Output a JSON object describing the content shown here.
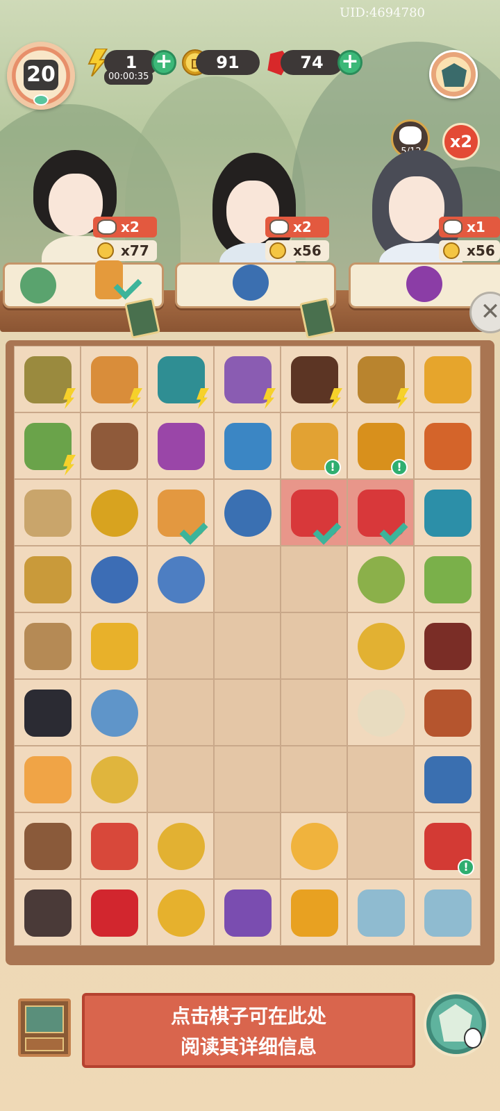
{
  "uid": "UID:4694780",
  "player": {
    "level": "20"
  },
  "resources": {
    "energy": "1",
    "energy_timer": "00:00:35",
    "coins": "91",
    "rubies": "74"
  },
  "cat_collection": {
    "count": "5/12",
    "multiplier": "x2"
  },
  "customers": [
    {
      "reward_cats": "x2",
      "reward_coins": "x77"
    },
    {
      "reward_cats": "x2",
      "reward_coins": "x56"
    },
    {
      "reward_cats": "x1",
      "reward_coins": "x56"
    }
  ],
  "info_panel": {
    "line1": "点击棋子可在此处",
    "line2": "阅读其详细信息"
  },
  "colors": {
    "accent_red": "#e3593f",
    "accent_green": "#3cb878",
    "board_wood": "#a97552",
    "cell": "#f1d9bd"
  },
  "board": [
    [
      "basket-of-thread",
      "fruit-crate",
      "teapot-set",
      "thread-spool",
      "treasure-chest",
      "tool-crate",
      "hen-nest"
    ],
    [
      "vegetable-basket",
      "bird-nest",
      "embroidered-pouch",
      "jeweled-hairpin",
      "coin-bag",
      "coin-pouch",
      "palace-lantern"
    ],
    [
      "calligraphy-brush",
      "gold-ring",
      "paper-lantern",
      "green-tea-bowl",
      "watermelon-plate",
      "watermelon-plate",
      "tea-jar"
    ],
    [
      "scroll-and-brush",
      "tea-cup",
      "tea-cup-blue",
      "",
      "",
      "mung-bean-soup",
      "bamboo-slips"
    ],
    [
      "silk-spindle",
      "flower-hairpin",
      "",
      "",
      "",
      "copper-coin",
      "wooden-box"
    ],
    [
      "black-cat",
      "porcelain-bowl",
      "",
      "",
      "",
      "rice-porridge",
      "cinnamon-bundle"
    ],
    [
      "orange-cat",
      "fried-rice",
      "",
      "",
      "",
      "",
      "hotpot"
    ],
    [
      "tabby-cat",
      "fruit-platter",
      "copper-coin",
      "",
      "fried-rice-egg",
      "",
      "red-lacquer-box"
    ],
    [
      "calico-cat",
      "ruby-cluster",
      "coin-pile",
      "energy-jar-purple",
      "energy-jar-gold",
      "cloud-pendant",
      "cloud-pendant"
    ]
  ]
}
